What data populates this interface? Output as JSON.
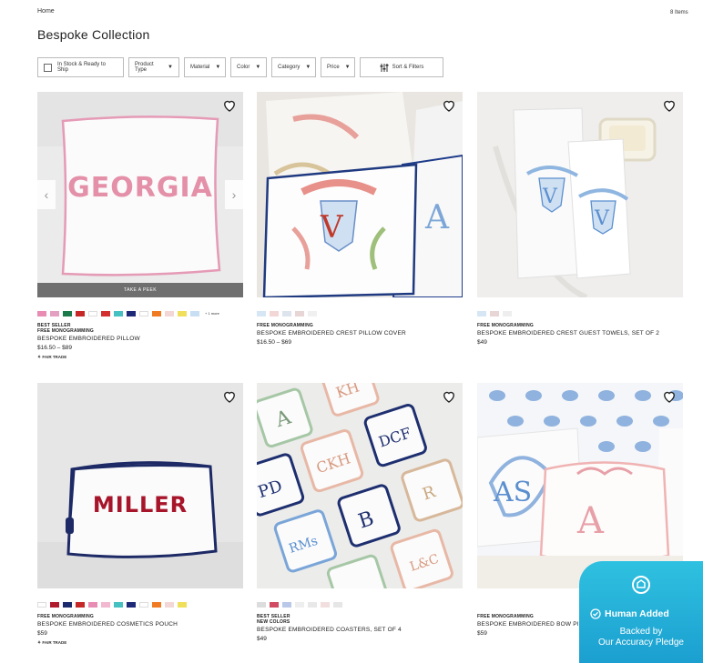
{
  "breadcrumb": "Home",
  "item_count": "8 Items",
  "page_title": "Bespoke Collection",
  "filters": {
    "in_stock": "In Stock & Ready to Ship",
    "product_type": "Product Type",
    "material": "Material",
    "color": "Color",
    "category": "Category",
    "price": "Price",
    "sort": "Sort & Filters"
  },
  "products": [
    {
      "badge1": "BEST SELLER",
      "badge2": "FREE MONOGRAMMING",
      "name": "BESPOKE EMBROIDERED PILLOW",
      "price": "$16.50 – $89",
      "fair_trade": "FAIR TRADE",
      "image_text": "GEORGIA",
      "peek": "TAKE A PEEK",
      "more_swatches": "+ 1 more",
      "swatches": [
        "#e88cb3",
        "#e4a0c0",
        "#1a7a4a",
        "#c62828",
        "#ffffff",
        "#d32f2f",
        "#46c0c0",
        "#1e2a78",
        "#ffffff",
        "#f07b22",
        "#f3d7d7",
        "#f0df5a",
        "#c8def2"
      ]
    },
    {
      "badge1": "FREE MONOGRAMMING",
      "name": "BESPOKE EMBROIDERED CREST PILLOW COVER",
      "price": "$16.50 – $69",
      "swatches": [
        "#d7e6f5",
        "#f3d7d7",
        "#dde4ee",
        "#e8d5d5",
        "#f0f0f0"
      ]
    },
    {
      "badge1": "FREE MONOGRAMMING",
      "name": "BESPOKE EMBROIDERED CREST GUEST TOWELS, SET OF 2",
      "price": "$49",
      "swatches": [
        "#d7e6f5",
        "#e8d5d5",
        "#eeeeee"
      ]
    },
    {
      "badge1": "FREE MONOGRAMMING",
      "name": "BESPOKE EMBROIDERED COSMETICS POUCH",
      "price": "$59",
      "fair_trade": "FAIR TRADE",
      "image_text": "MILLER",
      "swatches": [
        "#ffffff",
        "#b01c2e",
        "#1a2a6c",
        "#c62828",
        "#e88cb3",
        "#f2b8cf",
        "#46c0c0",
        "#1e2a78",
        "#ffffff",
        "#f07b22",
        "#f3d7d7",
        "#f0df5a"
      ]
    },
    {
      "badge1": "BEST SELLER",
      "badge2": "NEW COLORS",
      "name": "BESPOKE EMBROIDERED COASTERS, SET OF 4",
      "price": "$49",
      "swatches": [
        "#dcdcdc",
        "#d14b62",
        "#b9c8e8",
        "#eeeeee",
        "#e8e8e8",
        "#f2dede",
        "#e6e6e6"
      ]
    },
    {
      "badge1": "FREE MONOGRAMMING",
      "name": "BESPOKE EMBROIDERED BOW PILLOW COVER",
      "price": "$59",
      "swatches": []
    }
  ],
  "pledge": {
    "line1": "Human Added",
    "line2": "Backed by",
    "line3": "Our Accuracy Pledge"
  }
}
